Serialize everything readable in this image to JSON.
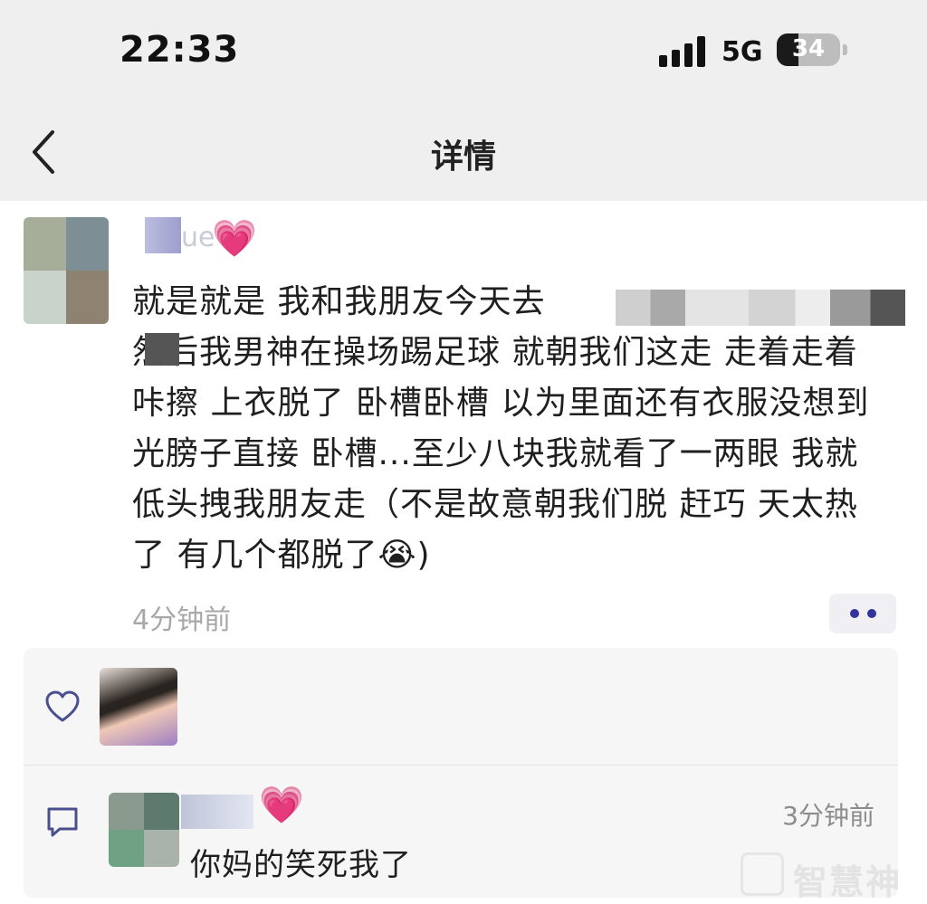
{
  "status_bar": {
    "time": "22:33",
    "network": "5G",
    "battery": "34",
    "battery_level": 0.34,
    "signal_bars": 4
  },
  "nav": {
    "title": "详情",
    "back_icon": "chevron-left-icon"
  },
  "post": {
    "author_heart": "💗",
    "name_fragment": "ue",
    "text": "就是就是 我和我朋友今天去\n然后我男神在操场踢足球 就朝我们这走 走着走着 咔擦 上衣脱了 卧槽卧槽 以为里面还有衣服没想到光膀子直接 卧槽...至少八块我就看了一两眼 我就低头拽我朋友走（不是故意朝我们脱 赶巧 天太热了 有几个都脱了😭)",
    "time": "4分钟前",
    "more_icon": "more-dots-icon"
  },
  "likes": {
    "like_icon": "heart-outline-icon"
  },
  "comments": [
    {
      "heart": "💗",
      "time": "3分钟前",
      "text": "你妈的笑死我了",
      "comment_icon": "comment-bubble-icon"
    }
  ],
  "watermark": {
    "text": "智慧神"
  },
  "colors": {
    "top_bar_bg": "#efefef",
    "pink_heart": "#ee3d96",
    "more_dots": "#333399",
    "muted_text": "#a8a8a8"
  }
}
